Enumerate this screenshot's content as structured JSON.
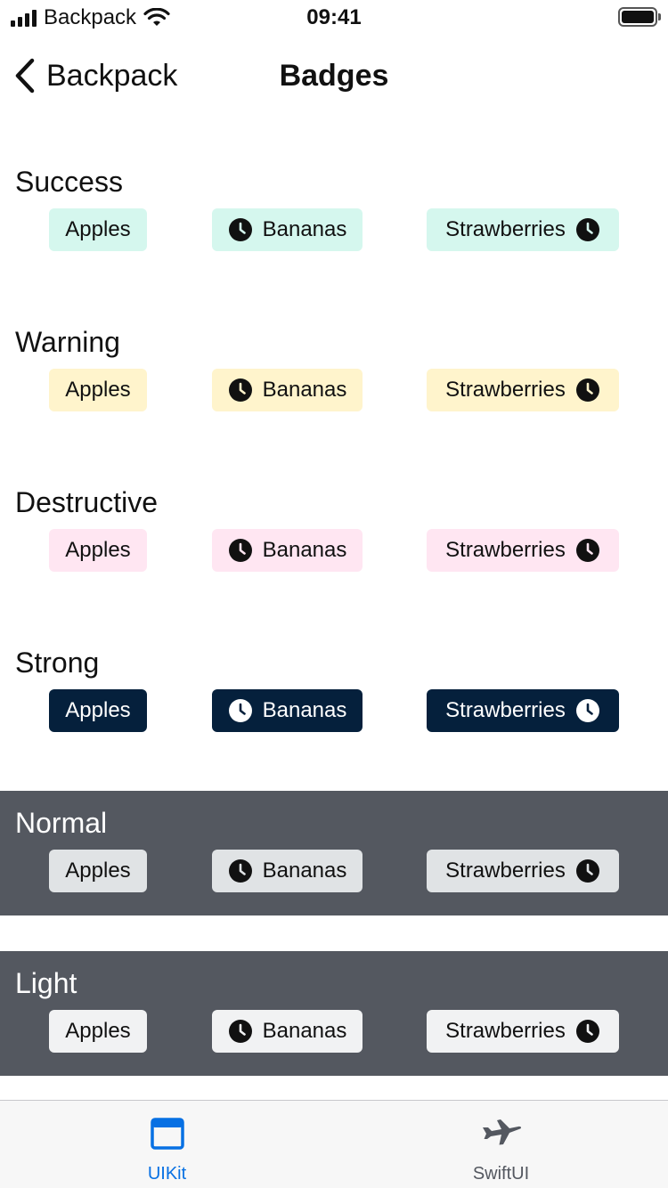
{
  "status_bar": {
    "carrier": "Backpack",
    "time": "09:41"
  },
  "nav": {
    "back_label": "Backpack",
    "title": "Badges"
  },
  "sections": [
    {
      "title": "Success",
      "badges": [
        "Apples",
        "Bananas",
        "Strawberries"
      ]
    },
    {
      "title": "Warning",
      "badges": [
        "Apples",
        "Bananas",
        "Strawberries"
      ]
    },
    {
      "title": "Destructive",
      "badges": [
        "Apples",
        "Bananas",
        "Strawberries"
      ]
    },
    {
      "title": "Strong",
      "badges": [
        "Apples",
        "Bananas",
        "Strawberries"
      ]
    },
    {
      "title": "Normal",
      "badges": [
        "Apples",
        "Bananas",
        "Strawberries"
      ]
    },
    {
      "title": "Light",
      "badges": [
        "Apples",
        "Bananas",
        "Strawberries"
      ]
    }
  ],
  "badge_icons": {
    "leading": "clock-icon",
    "trailing": "clock-icon"
  },
  "tab_bar": {
    "tabs": [
      {
        "label": "UIKit",
        "icon": "window-icon",
        "active": true
      },
      {
        "label": "SwiftUI",
        "icon": "airplane-icon",
        "active": false
      }
    ]
  },
  "colors": {
    "success_bg": "#d5f7ee",
    "warning_bg": "#fff4cc",
    "destructive_bg": "#ffe6f2",
    "strong_bg": "#05203c",
    "normal_bg": "#e0e3e5",
    "light_bg": "#f1f2f3",
    "dark_section_bg": "#545860",
    "accent": "#0770e3"
  }
}
